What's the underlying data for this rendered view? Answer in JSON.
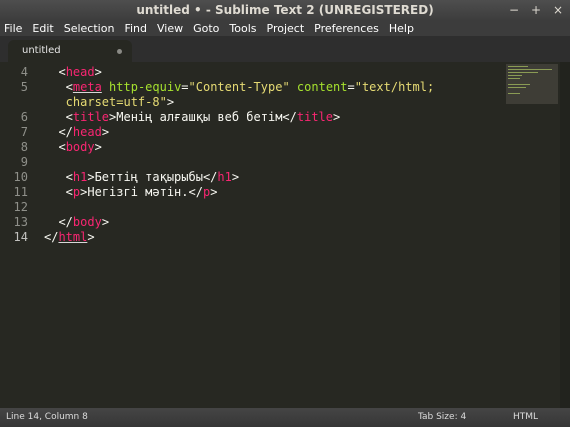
{
  "window": {
    "title": "untitled • - Sublime Text 2 (UNREGISTERED)",
    "controls": [
      "−",
      "+",
      "×"
    ]
  },
  "menu": [
    "File",
    "Edit",
    "Selection",
    "Find",
    "View",
    "Goto",
    "Tools",
    "Project",
    "Preferences",
    "Help"
  ],
  "tab": {
    "label": "untitled"
  },
  "editor": {
    "line_numbers": [
      "4",
      "5",
      "",
      "6",
      "7",
      "8",
      "9",
      "10",
      "11",
      "12",
      "13",
      "14"
    ],
    "active_line": "14"
  },
  "status": {
    "position": "Line 14, Column 8",
    "tab_size": "Tab Size: 4",
    "syntax": "HTML"
  },
  "colors": {
    "editor_bg": "#272822",
    "tag": "#f92672",
    "attribute": "#a6e22e",
    "string": "#e6db74",
    "text": "#f8f8f2"
  }
}
